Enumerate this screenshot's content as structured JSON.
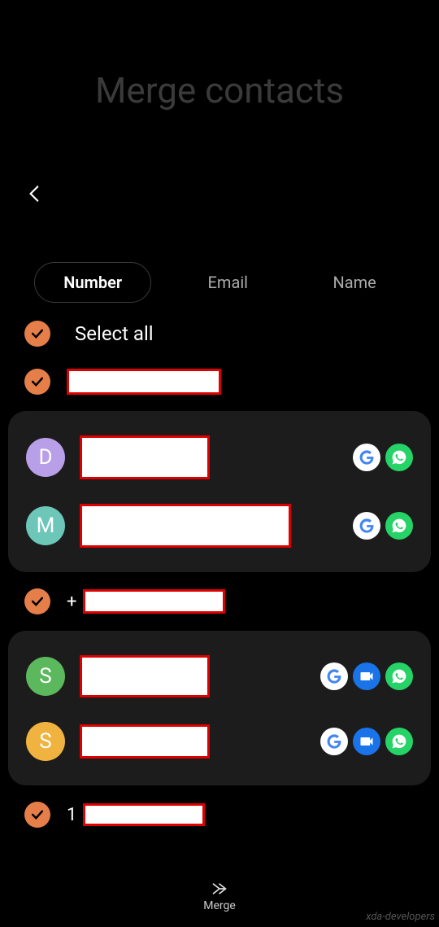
{
  "header": {
    "title": "Merge contacts"
  },
  "tabs": {
    "number": "Number",
    "email": "Email",
    "name": "Name",
    "active": "number"
  },
  "selectAll": {
    "label": "Select all",
    "checked": true
  },
  "groups": [
    {
      "headerChecked": true,
      "headerPrefix": "",
      "contacts": [
        {
          "initial": "D",
          "avatarColor": "#b89fe8",
          "apps": [
            "google",
            "whatsapp"
          ]
        },
        {
          "initial": "M",
          "avatarColor": "#6cc7b8",
          "apps": [
            "google",
            "whatsapp"
          ]
        }
      ]
    },
    {
      "headerChecked": true,
      "headerPrefix": "+",
      "contacts": [
        {
          "initial": "S",
          "avatarColor": "#5cb85c",
          "apps": [
            "google",
            "duo",
            "whatsapp"
          ]
        },
        {
          "initial": "S",
          "avatarColor": "#f0b340",
          "apps": [
            "google",
            "duo",
            "whatsapp"
          ]
        }
      ]
    },
    {
      "headerChecked": true,
      "headerPrefix": "1",
      "contacts": []
    }
  ],
  "bottomBar": {
    "merge": "Merge"
  },
  "watermark": "xda-developers"
}
